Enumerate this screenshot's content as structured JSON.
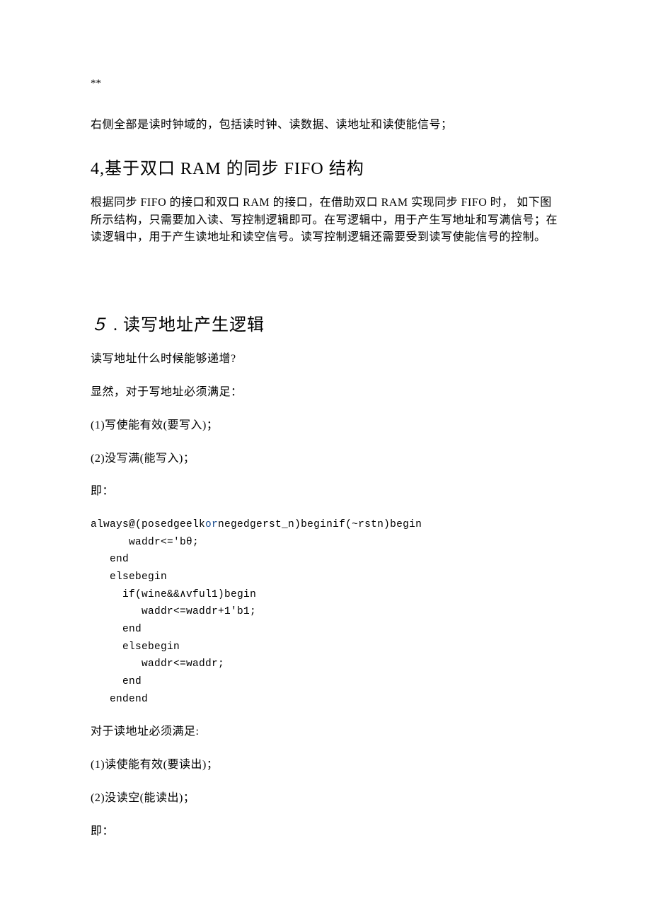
{
  "asterisks": "**",
  "intro_para": "右侧全部是读时钟域的，包括读时钟、读数据、读地址和读使能信号；",
  "heading4": "4,基于双口 RAM 的同步 FIFO 结构",
  "para4": "根据同步 FIFO 的接口和双口 RAM 的接口，在借助双口 RAM 实现同步 FIFO 时， 如下图所示结构，只需要加入读、写控制逻辑即可。在写逻辑中，用于产生写地址和写满信号；在读逻辑中，用于产生读地址和读空信号。读写控制逻辑还需要受到读写使能信号的控制。",
  "heading5_num": "５",
  "heading5_rest": " . 读写地址产生逻辑",
  "q1": "读写地址什么时候能够递增?",
  "q2": "显然，对于写地址必须满足：",
  "w1": "(1)写使能有效(要写入)；",
  "w2": "(2)没写满(能写入)；",
  "ie1": "即：",
  "code": {
    "line1_pre": "always@(posedgeelk",
    "line1_kw": "or",
    "line1_post": "negedgerst_n)beginif(~rstn)begin",
    "line2": "      waddr<='bθ;",
    "line3": "   end",
    "line4": "   elsebegin",
    "line5": "     if(wine&&∧vful1)begin",
    "line6": "        waddr<=waddr+1'b1;",
    "line7": "     end",
    "line8": "     elsebegin",
    "line9": "        waddr<=waddr;",
    "line10": "     end",
    "line11": "   endend"
  },
  "r0": "对于读地址必须满足:",
  "r1": "(1)读使能有效(要读出)；",
  "r2": "(2)没读空(能读出)；",
  "ie2": "即："
}
